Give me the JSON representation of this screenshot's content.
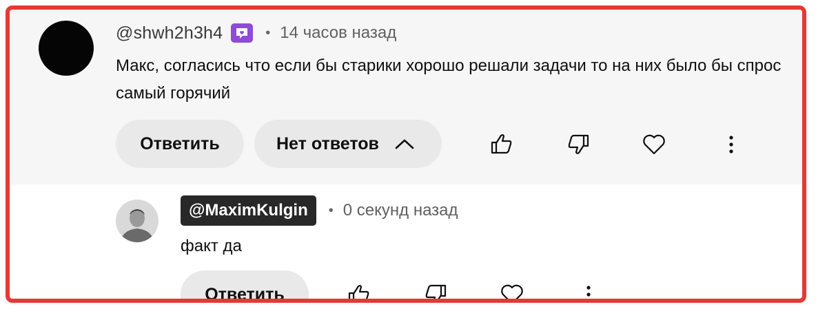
{
  "comment": {
    "author": "@shwh2h3h4",
    "badge_icon": "membership-heart-badge-icon",
    "separator": "•",
    "time": "14 часов назад",
    "text": "Макс, согласись что если бы старики хорошо решали задачи то на них было бы спрос самый горячий",
    "reply_label": "Ответить",
    "replies_label": "Нет ответов",
    "replies_icon": "chevron-up-icon",
    "like_icon": "thumbs-up-icon",
    "dislike_icon": "thumbs-down-icon",
    "heart_icon": "heart-icon",
    "more_icon": "more-vert-icon"
  },
  "reply": {
    "author": "@MaximKulgin",
    "separator": "•",
    "time": "0 секунд назад",
    "text": "факт да",
    "reply_label": "Ответить",
    "like_icon": "thumbs-up-icon",
    "dislike_icon": "thumbs-down-icon",
    "heart_icon": "heart-icon",
    "more_icon": "more-vert-icon"
  },
  "colors": {
    "highlight_border": "#e53935",
    "badge": "#8e4bd6",
    "owner_tag_bg": "#282828",
    "button_bg": "#e9e9e9",
    "top_comment_bg": "#f6f6f6"
  }
}
